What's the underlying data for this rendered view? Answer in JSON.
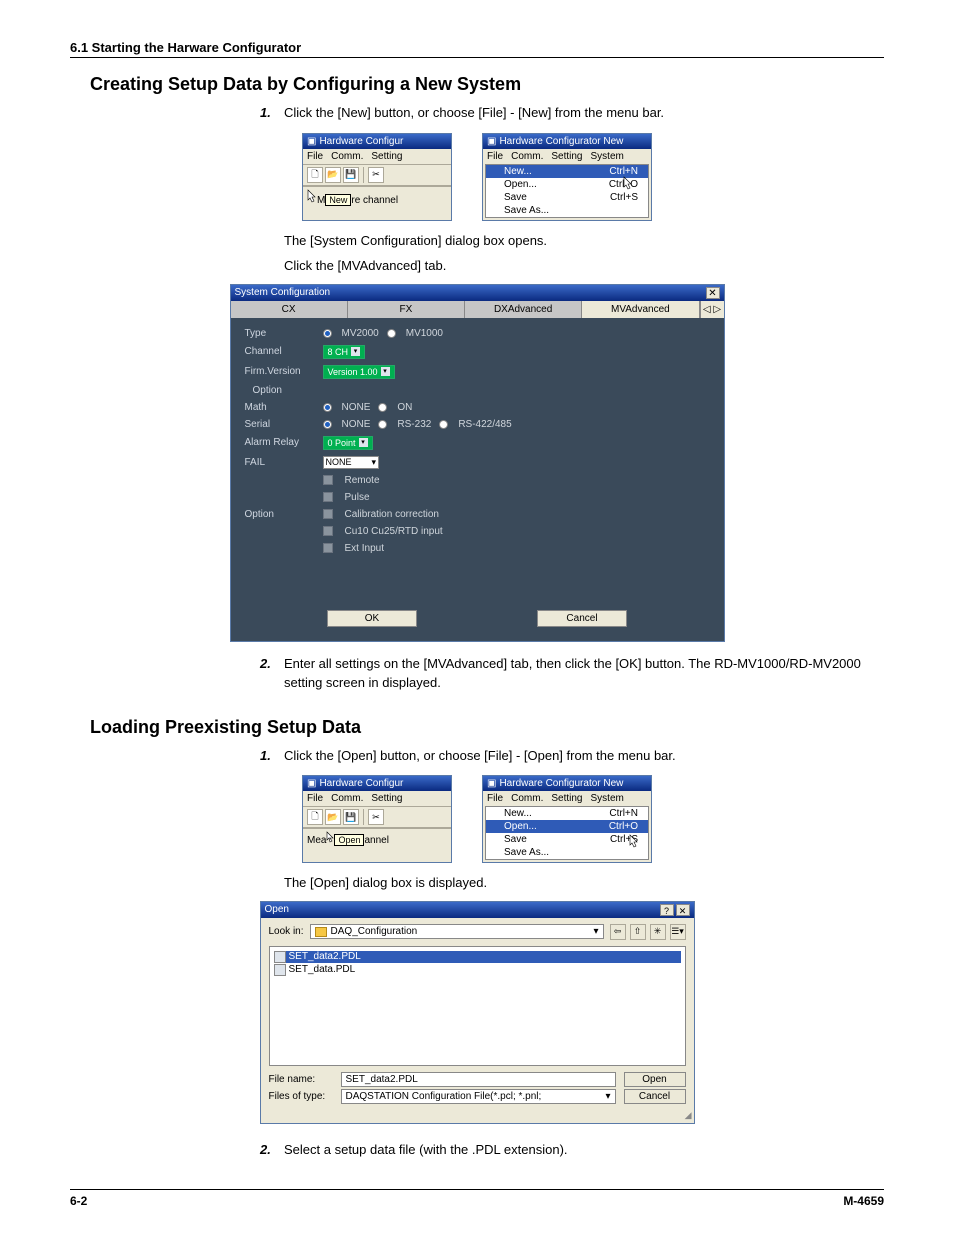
{
  "header": {
    "section": "6.1  Starting the Harware Configurator"
  },
  "h_create": "Creating Setup Data by Configuring a New System",
  "create_step1_num": "1.",
  "create_step1": "Click the [New] button, or choose [File] - [New] from the menu bar.",
  "create_after1a": "The [System Configuration] dialog box opens.",
  "create_after1b": "Click the [MVAdvanced] tab.",
  "create_step2_num": "2.",
  "create_step2": "Enter all settings on the [MVAdvanced] tab, then click the [OK] button. The RD-MV1000/RD-MV2000 setting screen in displayed.",
  "h_load": "Loading Preexisting Setup Data",
  "load_step1_num": "1.",
  "load_step1": "Click the [Open] button, or choose [File] - [Open] from the menu bar.",
  "load_after1": "The [Open] dialog box is displayed.",
  "load_step2_num": "2.",
  "load_step2": "Select a setup data file (with the .PDL extension).",
  "win1": {
    "title": "Hardware Configur",
    "menu": {
      "file": "File",
      "comm": "Comm.",
      "setting": "Setting"
    },
    "status_pre": "M",
    "tooltip": "New",
    "status_post": "re channel"
  },
  "menuwin1": {
    "title": "Hardware Configurator New",
    "menu": {
      "file": "File",
      "comm": "Comm.",
      "setting": "Setting",
      "system": "System"
    },
    "items": [
      {
        "label": "New...",
        "short": "Ctrl+N",
        "hover": true
      },
      {
        "label": "Open...",
        "short": "Ctrl+O",
        "hover": false
      },
      {
        "label": "Save",
        "short": "Ctrl+S",
        "hover": false
      },
      {
        "label": "Save As...",
        "short": "",
        "hover": false
      }
    ]
  },
  "dlg": {
    "title": "System Configuration",
    "tabs": {
      "cx": "CX",
      "fx": "FX",
      "dxa": "DXAdvanced",
      "mva": "MVAdvanced"
    },
    "type_label": "Type",
    "type_a": "MV2000",
    "type_b": "MV1000",
    "channel_label": "Channel",
    "channel_val": "8 CH",
    "firm_label": "Firm.Version",
    "firm_val": "Version 1.00",
    "option_top": "Option",
    "math_label": "Math",
    "math_a": "NONE",
    "math_b": "ON",
    "serial_label": "Serial",
    "serial_a": "NONE",
    "serial_b": "RS-232",
    "serial_c": "RS-422/485",
    "alarm_label": "Alarm Relay",
    "alarm_val": "0 Point",
    "fail_label": "FAIL",
    "fail_val": "NONE",
    "chk_remote": "Remote",
    "chk_pulse": "Pulse",
    "option_label": "Option",
    "chk_cal": "Calibration correction",
    "chk_cu": "Cu10 Cu25/RTD input",
    "chk_ext": "Ext Input",
    "ok": "OK",
    "cancel": "Cancel"
  },
  "win2": {
    "title": "Hardware Configur",
    "menu": {
      "file": "File",
      "comm": "Comm.",
      "setting": "Setting"
    },
    "status_pre": "Mea",
    "tooltip": "Open",
    "status_post": "annel"
  },
  "menuwin2": {
    "title": "Hardware Configurator New",
    "menu": {
      "file": "File",
      "comm": "Comm.",
      "setting": "Setting",
      "system": "System"
    },
    "items": [
      {
        "label": "New...",
        "short": "Ctrl+N",
        "hover": false
      },
      {
        "label": "Open...",
        "short": "Ctrl+O",
        "hover": true
      },
      {
        "label": "Save",
        "short": "Ctrl+S",
        "hover": false
      },
      {
        "label": "Save As...",
        "short": "",
        "hover": false
      }
    ]
  },
  "open": {
    "title": "Open",
    "lookin_label": "Look in:",
    "folder": "DAQ_Configuration",
    "file1": "SET_data2.PDL",
    "file2": "SET_data.PDL",
    "filename_label": "File name:",
    "filename_val": "SET_data2.PDL",
    "filetype_label": "Files of type:",
    "filetype_val": "DAQSTATION Configuration File(*.pcl; *.pnl;",
    "open_btn": "Open",
    "cancel_btn": "Cancel"
  },
  "footer": {
    "page": "6-2",
    "doc": "M-4659"
  }
}
